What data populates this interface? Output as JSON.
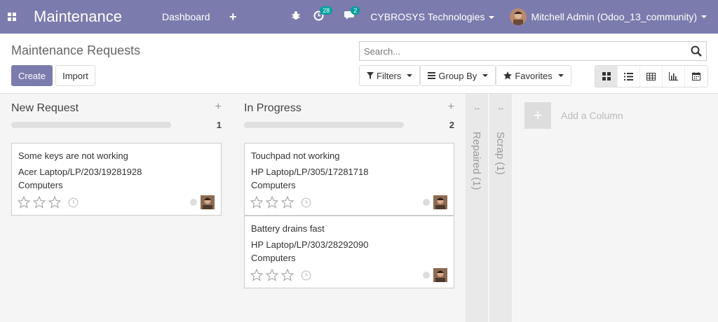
{
  "navbar": {
    "app_title": "Maintenance",
    "dashboard": "Dashboard",
    "plus": "+",
    "activity_count": "28",
    "messages_count": "2",
    "company": "CYBROSYS Technologies",
    "user": "Mitchell Admin (Odoo_13_community)"
  },
  "control": {
    "breadcrumb": "Maintenance Requests",
    "create": "Create",
    "import": "Import",
    "search_placeholder": "Search...",
    "filters": "Filters",
    "group_by": "Group By",
    "favorites": "Favorites"
  },
  "kanban": {
    "columns": [
      {
        "title": "New Request",
        "count": "1",
        "cards": [
          {
            "title": "Some keys are not working",
            "equipment": "Acer Laptop/LP/203/19281928",
            "category": "Computers"
          }
        ]
      },
      {
        "title": "In Progress",
        "count": "2",
        "cards": [
          {
            "title": "Touchpad not working",
            "equipment": "HP Laptop/LP/305/17281718",
            "category": "Computers"
          },
          {
            "title": "Battery drains fast",
            "equipment": "HP Laptop/LP/303/28292090",
            "category": "Computers"
          }
        ]
      }
    ],
    "folded": [
      {
        "label": "Repaired (1)"
      },
      {
        "label": "Scrap (1)"
      }
    ],
    "add_column": "Add a Column",
    "column_add_symbol": "+"
  },
  "colors": {
    "navbar": "#7c7bad",
    "primary_button": "#7c7bad",
    "badge": "#00a09d"
  }
}
